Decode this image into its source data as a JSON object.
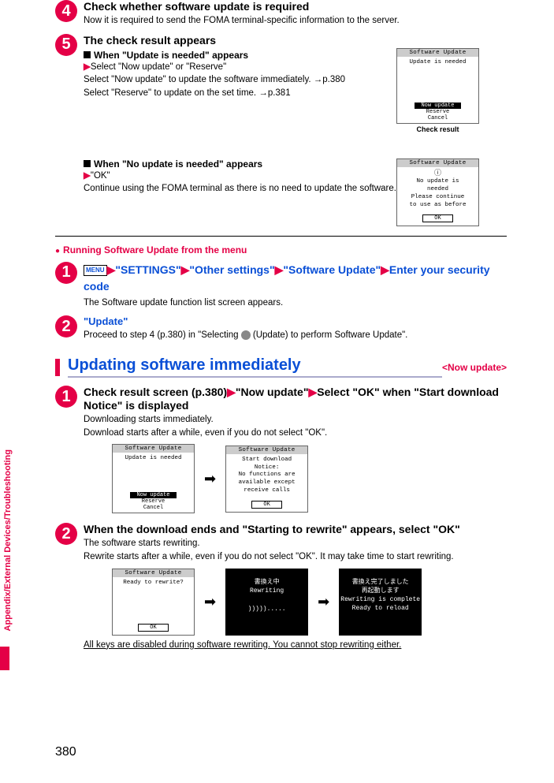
{
  "step4": {
    "num": "4",
    "head": "Check whether software update is required",
    "text": "Now it is required to send the FOMA terminal-specific information to the server."
  },
  "step5": {
    "num": "5",
    "head": "The check result appears",
    "sub1_head": "When \"Update is needed\" appears",
    "sub1_l1_pre": "Select \"Now update\" or \"Reserve\"",
    "sub1_l2": "Select \"Now update\" to update the software immediately. →p.380",
    "sub1_l3": "Select \"Reserve\" to update on the set time. →p.381",
    "sub2_head": "When \"No update is needed\" appears",
    "sub2_l1": "\"OK\"",
    "sub2_l2": "Continue using the FOMA terminal as there is no need to update the software."
  },
  "screen_checkresult": {
    "title": "Software Update",
    "body": "Update is needed",
    "m1": "Now update",
    "m2": "Reserve",
    "m3": "Cancel",
    "caption": "Check result"
  },
  "screen_noupdate": {
    "title": "Software Update",
    "l1": "No update is",
    "l2": "needed",
    "l3": "Please continue",
    "l4": "to use as before",
    "ok": "OK"
  },
  "runmenu": {
    "head": "Running Software Update from the menu"
  },
  "menu_step1": {
    "num": "1",
    "menu_label": "MENU",
    "p1": "\"SETTINGS\"",
    "p2": "\"Other settings\"",
    "p3": "\"Software Update\"",
    "p4": "Enter your security code",
    "text": "The Software update function list screen appears."
  },
  "menu_step2": {
    "num": "2",
    "head": "\"Update\"",
    "text_a": "Proceed to step 4 (p.380) in \"Selecting ",
    "text_b": " (Update) to perform Software Update\"."
  },
  "section2": {
    "title": "Updating software immediately",
    "tag": "<Now update>"
  },
  "now_step1": {
    "num": "1",
    "head_a": "Check result screen (p.380)",
    "head_b": "\"Now update\"",
    "head_c": "Select \"OK\" when \"Start download Notice\" is displayed",
    "l1": "Downloading starts immediately.",
    "l2": "Download starts after a while, even if you do not select \"OK\"."
  },
  "screen_notice": {
    "title": "Software Update",
    "l1": "Start download Notice:",
    "l2": "No functions are",
    "l3": "available except",
    "l4": "receive calls",
    "ok": "OK"
  },
  "now_step2": {
    "num": "2",
    "head": "When the download ends and \"Starting to rewrite\" appears, select \"OK\"",
    "l1": "The software starts rewriting.",
    "l2": "Rewrite starts after a while, even if you do not select \"OK\". It may take time to start rewriting.",
    "note": "All keys are disabled during software rewriting. You cannot stop rewriting either."
  },
  "screen_ready": {
    "title": "Software Update",
    "body": "Ready to rewrite?",
    "ok": "OK"
  },
  "screen_rewriting": {
    "jp": "書換え中",
    "en": "Rewriting",
    "dots": ")))))....."
  },
  "screen_complete": {
    "jp1": "書換え完了しました",
    "jp2": "再起動します",
    "en1": "Rewriting is complete",
    "en2": "Ready to reload"
  },
  "sidetab": "Appendix/External Devices/Troubleshooting",
  "pagenum": "380"
}
